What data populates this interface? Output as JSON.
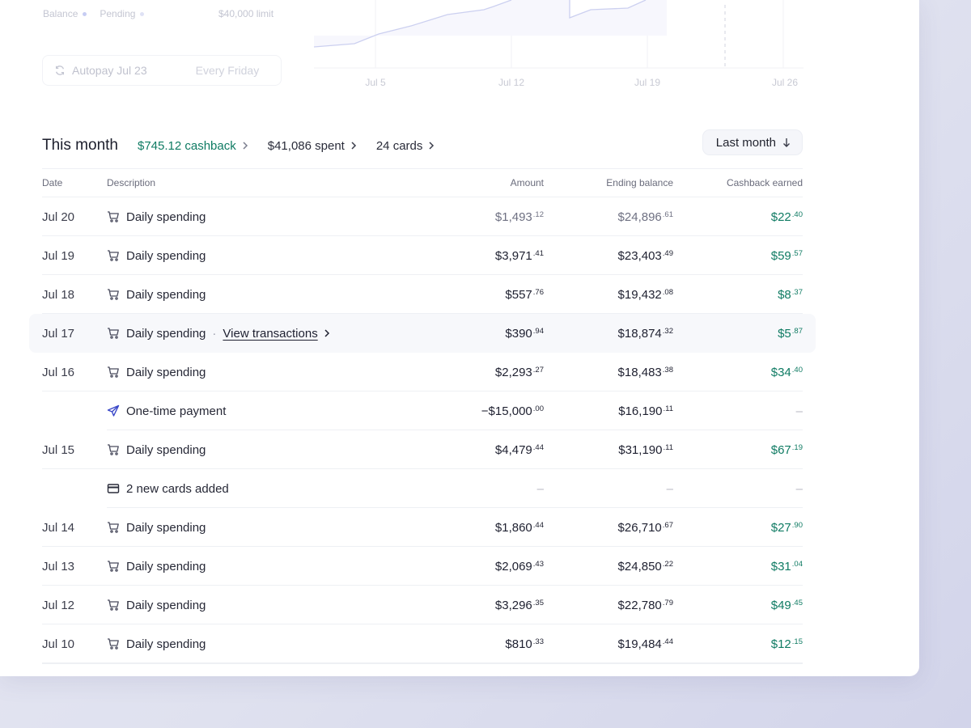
{
  "top": {
    "legend": {
      "balance": "Balance",
      "pending": "Pending",
      "limit": "$40,000 limit"
    },
    "autopay": {
      "label": "Autopay Jul 23",
      "frequency": "Every Friday"
    },
    "chart_ticks": [
      "Jul 5",
      "Jul 12",
      "Jul 19",
      "Jul 26"
    ],
    "colors": {
      "balance_dot": "#c7cdf3",
      "pending_dot": "#dfe2f5",
      "line": "#c9ccef"
    }
  },
  "summary": {
    "title": "This month",
    "cashback": "$745.12 cashback",
    "spent": "$41,086 spent",
    "cards": "24 cards",
    "filter": "Last month"
  },
  "table": {
    "headers": {
      "date": "Date",
      "description": "Description",
      "amount": "Amount",
      "ending_balance": "Ending balance",
      "cashback": "Cashback earned"
    },
    "view_link": "View transactions",
    "rows": [
      {
        "date": "Jul 20",
        "icon": "cart-icon",
        "desc": "Daily spending",
        "amount": [
          "$1,493",
          ".12"
        ],
        "balance": [
          "$24,896",
          ".61"
        ],
        "cashback": [
          "$22",
          ".40"
        ]
      },
      {
        "date": "Jul 19",
        "icon": "cart-icon",
        "desc": "Daily spending",
        "amount": [
          "$3,971",
          ".41"
        ],
        "balance": [
          "$23,403",
          ".49"
        ],
        "cashback": [
          "$59",
          ".57"
        ]
      },
      {
        "date": "Jul 18",
        "icon": "cart-icon",
        "desc": "Daily spending",
        "amount": [
          "$557",
          ".76"
        ],
        "balance": [
          "$19,432",
          ".08"
        ],
        "cashback": [
          "$8",
          ".37"
        ]
      },
      {
        "date": "Jul 17",
        "icon": "cart-icon",
        "desc": "Daily spending",
        "amount": [
          "$390",
          ".94"
        ],
        "balance": [
          "$18,874",
          ".32"
        ],
        "cashback": [
          "$5",
          ".87"
        ]
      },
      {
        "date": "Jul 16",
        "icon": "cart-icon",
        "desc": "Daily spending",
        "amount": [
          "$2,293",
          ".27"
        ],
        "balance": [
          "$18,483",
          ".38"
        ],
        "cashback": [
          "$34",
          ".40"
        ]
      },
      {
        "date": "",
        "icon": "send-icon",
        "desc": "One-time payment",
        "amount": [
          "−$15,000",
          ".00"
        ],
        "balance": [
          "$16,190",
          ".11"
        ],
        "cashback": "–"
      },
      {
        "date": "Jul 15",
        "icon": "cart-icon",
        "desc": "Daily spending",
        "amount": [
          "$4,479",
          ".44"
        ],
        "balance": [
          "$31,190",
          ".11"
        ],
        "cashback": [
          "$67",
          ".19"
        ]
      },
      {
        "date": "",
        "icon": "credit-card-icon",
        "desc": "2 new cards added",
        "amount": "–",
        "balance": "–",
        "cashback": "–"
      },
      {
        "date": "Jul 14",
        "icon": "cart-icon",
        "desc": "Daily spending",
        "amount": [
          "$1,860",
          ".44"
        ],
        "balance": [
          "$26,710",
          ".67"
        ],
        "cashback": [
          "$27",
          ".90"
        ]
      },
      {
        "date": "Jul 13",
        "icon": "cart-icon",
        "desc": "Daily spending",
        "amount": [
          "$2,069",
          ".43"
        ],
        "balance": [
          "$24,850",
          ".22"
        ],
        "cashback": [
          "$31",
          ".04"
        ]
      },
      {
        "date": "Jul 12",
        "icon": "cart-icon",
        "desc": "Daily spending",
        "amount": [
          "$3,296",
          ".35"
        ],
        "balance": [
          "$22,780",
          ".79"
        ],
        "cashback": [
          "$49",
          ".45"
        ]
      },
      {
        "date": "Jul 10",
        "icon": "cart-icon",
        "desc": "Daily spending",
        "amount": [
          "$810",
          ".33"
        ],
        "balance": [
          "$19,484",
          ".44"
        ],
        "cashback": [
          "$12",
          ".15"
        ]
      }
    ]
  }
}
